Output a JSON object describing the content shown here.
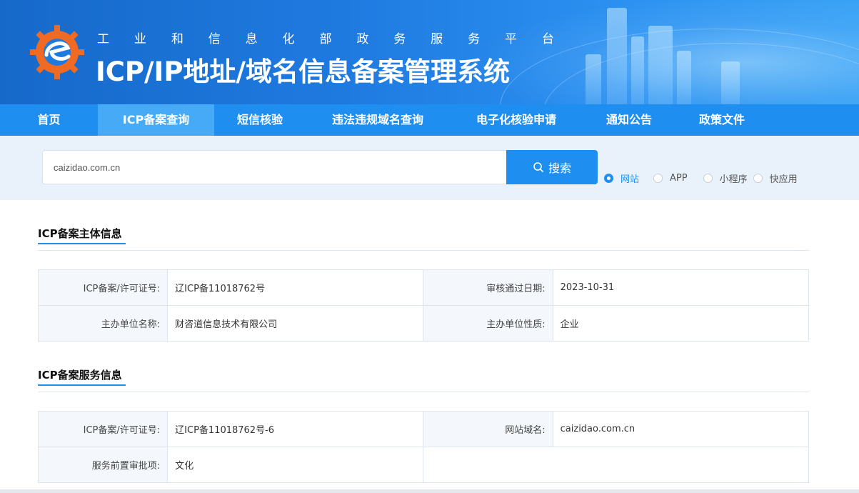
{
  "header": {
    "subtitle_chars": [
      "工",
      "业",
      "和",
      "信",
      "息",
      "化",
      "部",
      "政",
      "务",
      "服",
      "务",
      "平",
      "台"
    ],
    "title": "ICP/IP地址/域名信息备案管理系统",
    "colors": {
      "banner": "#1f7ae0",
      "nav": "#1e8ff0",
      "nav_active": "#47aaf7",
      "logo_orange": "#f06a23"
    }
  },
  "nav": {
    "items": [
      {
        "label": "首页"
      },
      {
        "label": "ICP备案查询",
        "active": true
      },
      {
        "label": "短信核验"
      },
      {
        "label": "违法违规域名查询"
      },
      {
        "label": "电子化核验申请"
      },
      {
        "label": "通知公告"
      },
      {
        "label": "政策文件"
      }
    ]
  },
  "search": {
    "value": "caizidao.com.cn",
    "button_label": "搜索",
    "options": [
      {
        "label": "网站",
        "checked": true
      },
      {
        "label": "APP",
        "checked": false
      },
      {
        "label": "小程序",
        "checked": false
      },
      {
        "label": "快应用",
        "checked": false
      }
    ]
  },
  "subject_info": {
    "title": "ICP备案主体信息",
    "rows": [
      {
        "l1": "ICP备案/许可证号:",
        "v1": "辽ICP备11018762号",
        "l2": "审核通过日期:",
        "v2": "2023-10-31"
      },
      {
        "l1": "主办单位名称:",
        "v1": "财咨道信息技术有限公司",
        "l2": "主办单位性质:",
        "v2": "企业"
      }
    ]
  },
  "service_info": {
    "title": "ICP备案服务信息",
    "rows": [
      {
        "l1": "ICP备案/许可证号:",
        "v1": "辽ICP备11018762号-6",
        "l2": "网站域名:",
        "v2": "caizidao.com.cn"
      },
      {
        "l1": "服务前置审批项:",
        "v1": "文化",
        "l2": "",
        "v2": ""
      }
    ]
  }
}
